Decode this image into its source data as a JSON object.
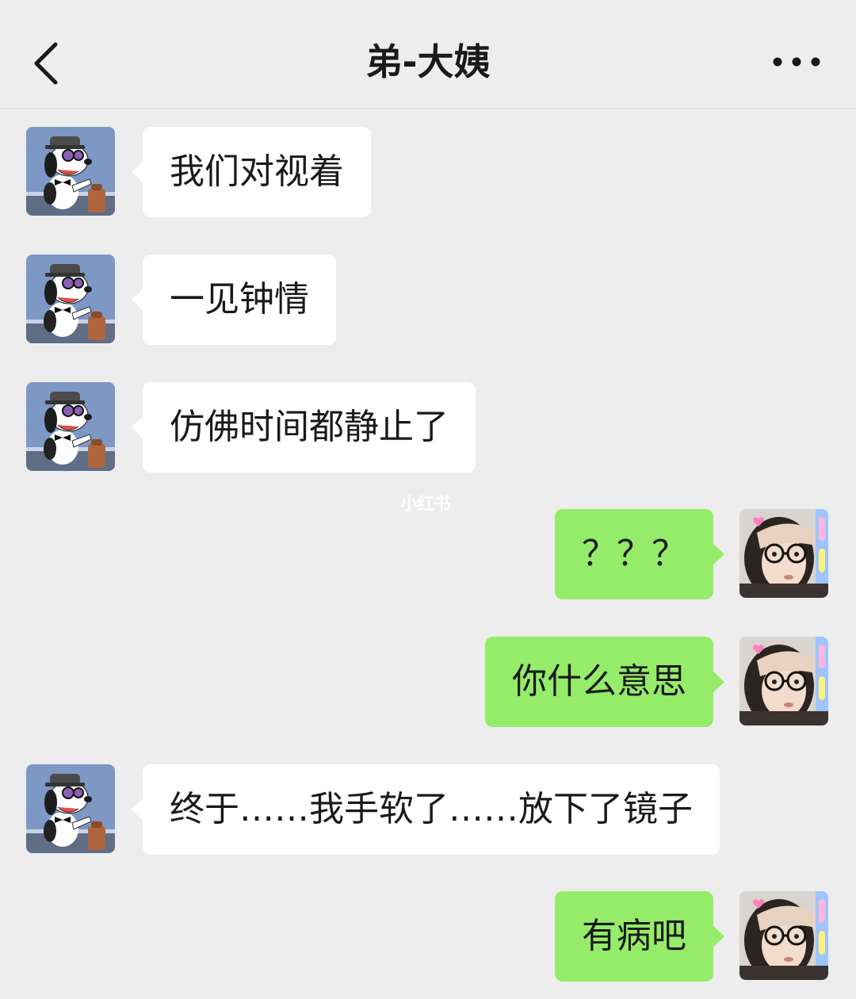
{
  "header": {
    "title": "弟-大姨",
    "back_icon": "chevron-left-icon",
    "more_icon": "more-dots-icon"
  },
  "watermark": "小红书",
  "colors": {
    "background": "#ededed",
    "received_bubble": "#ffffff",
    "sent_bubble": "#95ec69"
  },
  "messages": [
    {
      "side": "left",
      "sender": "contact",
      "text": "我们对视着"
    },
    {
      "side": "left",
      "sender": "contact",
      "text": "一见钟情"
    },
    {
      "side": "left",
      "sender": "contact",
      "text": "仿佛时间都静止了"
    },
    {
      "side": "right",
      "sender": "me",
      "text": "？？？"
    },
    {
      "side": "right",
      "sender": "me",
      "text": "你什么意思"
    },
    {
      "side": "left",
      "sender": "contact",
      "text": "终于……我手软了……放下了镜子"
    },
    {
      "side": "right",
      "sender": "me",
      "text": "有病吧"
    }
  ]
}
